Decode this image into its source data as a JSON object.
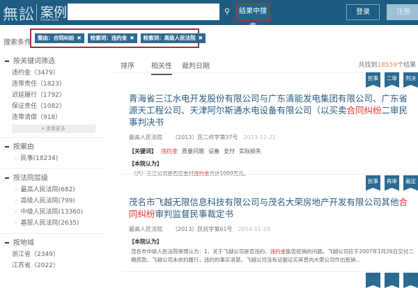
{
  "header": {
    "logo": "無訟",
    "logo_name": "案例",
    "logo_sub": "itslaw.com",
    "search_value": "",
    "search_icon": "search-icon",
    "search_in_results": "结果中搜索",
    "login": "登录",
    "register": "注册"
  },
  "conditions": {
    "label": "搜索条件",
    "tags": [
      {
        "label": "案由：合同纠纷"
      },
      {
        "label": "检索词：违约金"
      },
      {
        "label": "检索词：高级人民法院"
      }
    ],
    "remove_icon": "✖"
  },
  "sidebar": {
    "keyword": {
      "title": "按关键词筛选",
      "items": [
        "违约金（3479）",
        "连带责任（1823）",
        "迟延履行（1792）",
        "保证责任（1082）",
        "连带清偿（918）"
      ],
      "more": "▾ 查看更多"
    },
    "cause": {
      "title": "按案由",
      "items": [
        "民事(18234)"
      ]
    },
    "court": {
      "title": "按法院层级",
      "items": [
        "最高人民法院(682)",
        "高级人民法院(799)",
        "中级人民法院(13360)",
        "基层人民法院(2635)"
      ]
    },
    "region": {
      "title": "按地域",
      "items": [
        "浙江省（2349）",
        "江苏省（2022）"
      ]
    }
  },
  "main": {
    "sort_label": "排序",
    "tabs": [
      "相关性",
      "裁判日期"
    ],
    "total_prefix": "共找到",
    "total": "18559",
    "total_suffix": "个结果",
    "results": [
      {
        "badges": [
          "民事",
          "二审",
          "判决"
        ],
        "title_a": "青海省三江水电开发股份有限公司与广东清能发电集团有限公司、广东省源天工程公司、天津阿尔斯通水电设备有限公司（以买卖",
        "title_hl": "合同纠纷",
        "title_b": "二审民事判决书",
        "court": "最高人民法院",
        "case_no": "（2013）民二终字第37号",
        "date": "2013-12-21",
        "kw_label": "【关键词】",
        "keywords": [
          "违约金",
          "质量问题",
          "设备",
          "支付",
          "实际损失"
        ],
        "opinion_label": "【本院认为】",
        "text_a": "（六）三江公司是否应支付",
        "text_hl": "违约金",
        "text_b": "共计1000万元。"
      },
      {
        "badges": [
          "民事",
          "再审",
          "裁定"
        ],
        "title_a": "茂名市飞越无限信息科技有限公司与茂名大荣房地产开发有限公司其他",
        "title_hl": "合同纠纷",
        "title_b": "审判监督民事裁定书",
        "court": "最高人民法院",
        "case_no": "（2013）民抗字第61号",
        "date": "2014-11-28",
        "opinion_label": "【本院认为】",
        "text_a": "茂名市中级人民法院审理认为：1、关于飞越公司是否违约、",
        "text_hl": "违约金",
        "text_b": "能否抵销的问题。飞越公司应于2007年1月26日交付二期房款，飞越公司未依约履行，违约的事实清楚。飞越公司没有证据证实其曾向大荣公司作出抵销…"
      }
    ]
  }
}
